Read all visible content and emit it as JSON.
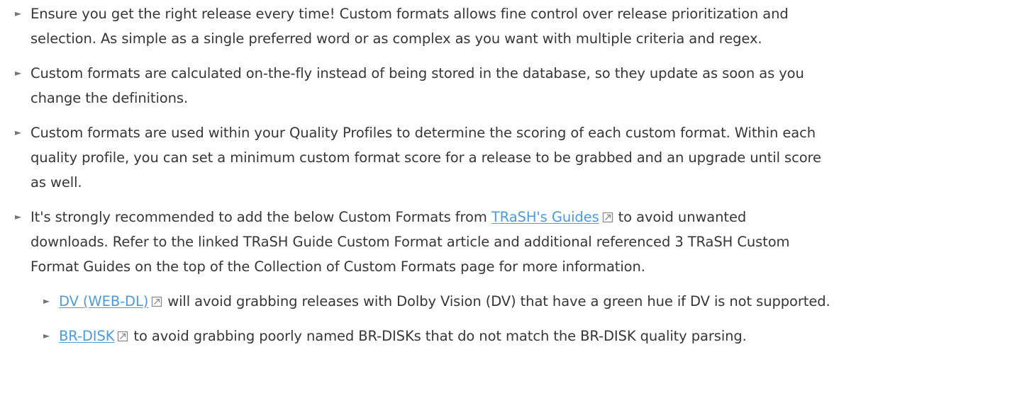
{
  "items": [
    {
      "lines": [
        "Ensure you get the right release every time! Custom formats allows fine control over release prioritization and",
        "selection. As simple as a single preferred word or as complex as you want with multiple criteria and regex."
      ]
    },
    {
      "lines": [
        "Custom formats are calculated on-the-fly instead of being stored in the database, so they update as soon as you",
        "change the definitions."
      ]
    },
    {
      "lines": [
        "Custom formats are used within your Quality Profiles to determine the scoring of each custom format. Within each",
        "quality profile, you can set a minimum custom format score for a release to be grabbed and an upgrade until score",
        "as well."
      ]
    },
    {
      "before_link": "It's strongly recommended to add the below Custom Formats from ",
      "link": "TRaSH's Guides",
      "after_link_line1": "to avoid unwanted",
      "lines": [
        "downloads. Refer to the linked TRaSH Guide Custom Format article and additional referenced 3 TRaSH Custom",
        "Format Guides on the top of the Collection of Custom Formats page for more information."
      ]
    }
  ],
  "subitems": [
    {
      "link": "DV (WEB-DL)",
      "text": "will avoid grabbing releases with Dolby Vision (DV) that have a green hue if DV is not supported."
    },
    {
      "link": "BR-DISK",
      "text": "to avoid grabbing poorly named BR-DISKs that do not match the BR-DISK quality parsing."
    }
  ],
  "marker_glyph": "►",
  "link_color": "#4a9bdd",
  "text_color": "#363636"
}
